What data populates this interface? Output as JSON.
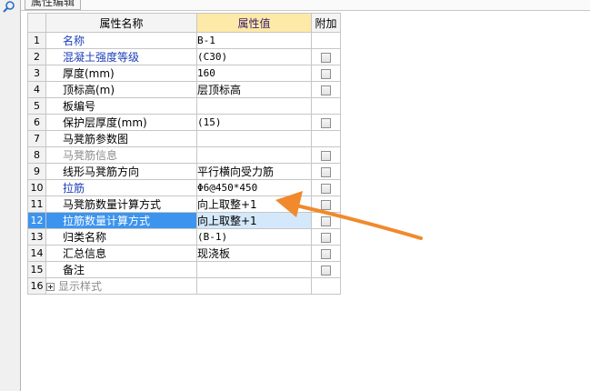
{
  "panel": {
    "title": "属性编辑"
  },
  "grid": {
    "columns": [
      "属性名称",
      "属性值",
      "附加"
    ],
    "rows": [
      {
        "num": "1",
        "name": "名称",
        "value": "B-1",
        "style": "blue",
        "check": false
      },
      {
        "num": "2",
        "name": "混凝土强度等级",
        "value": "(C30)",
        "style": "blue",
        "check": true
      },
      {
        "num": "3",
        "name": "厚度(mm)",
        "value": "160",
        "style": "",
        "check": true
      },
      {
        "num": "4",
        "name": "顶标高(m)",
        "value": "层顶标高",
        "style": "",
        "check": true
      },
      {
        "num": "5",
        "name": "板编号",
        "value": "",
        "style": "",
        "check": false
      },
      {
        "num": "6",
        "name": "保护层厚度(mm)",
        "value": "(15)",
        "style": "",
        "check": true
      },
      {
        "num": "7",
        "name": "马凳筋参数图",
        "value": "",
        "style": "",
        "check": false
      },
      {
        "num": "8",
        "name": "马凳筋信息",
        "value": "",
        "style": "grey",
        "check": true
      },
      {
        "num": "9",
        "name": "线形马凳筋方向",
        "value": "平行横向受力筋",
        "style": "",
        "check": true
      },
      {
        "num": "10",
        "name": "拉筋",
        "value": "Φ6@450*450",
        "style": "blue",
        "check": true
      },
      {
        "num": "11",
        "name": "马凳筋数量计算方式",
        "value": "向上取整+1",
        "style": "",
        "check": true
      },
      {
        "num": "12",
        "name": "拉筋数量计算方式",
        "value": "向上取整+1",
        "style": "selected",
        "check": true
      },
      {
        "num": "13",
        "name": "归类名称",
        "value": "(B-1)",
        "style": "",
        "check": true
      },
      {
        "num": "14",
        "name": "汇总信息",
        "value": "现浇板",
        "style": "",
        "check": true
      },
      {
        "num": "15",
        "name": "备注",
        "value": "",
        "style": "",
        "check": true
      },
      {
        "num": "16",
        "name": "显示样式",
        "value": "",
        "style": "group",
        "check": false
      }
    ]
  },
  "colors": {
    "selection": "#3c94ee",
    "selection_value": "#d3e9fb",
    "header_value": "#fde9a8",
    "link_blue": "#1d3fb8",
    "arrow": "#f08a2c"
  },
  "icons": {
    "search": "search-icon",
    "expand": "expand-plus-icon",
    "arrow": "annotation-arrow-icon"
  }
}
